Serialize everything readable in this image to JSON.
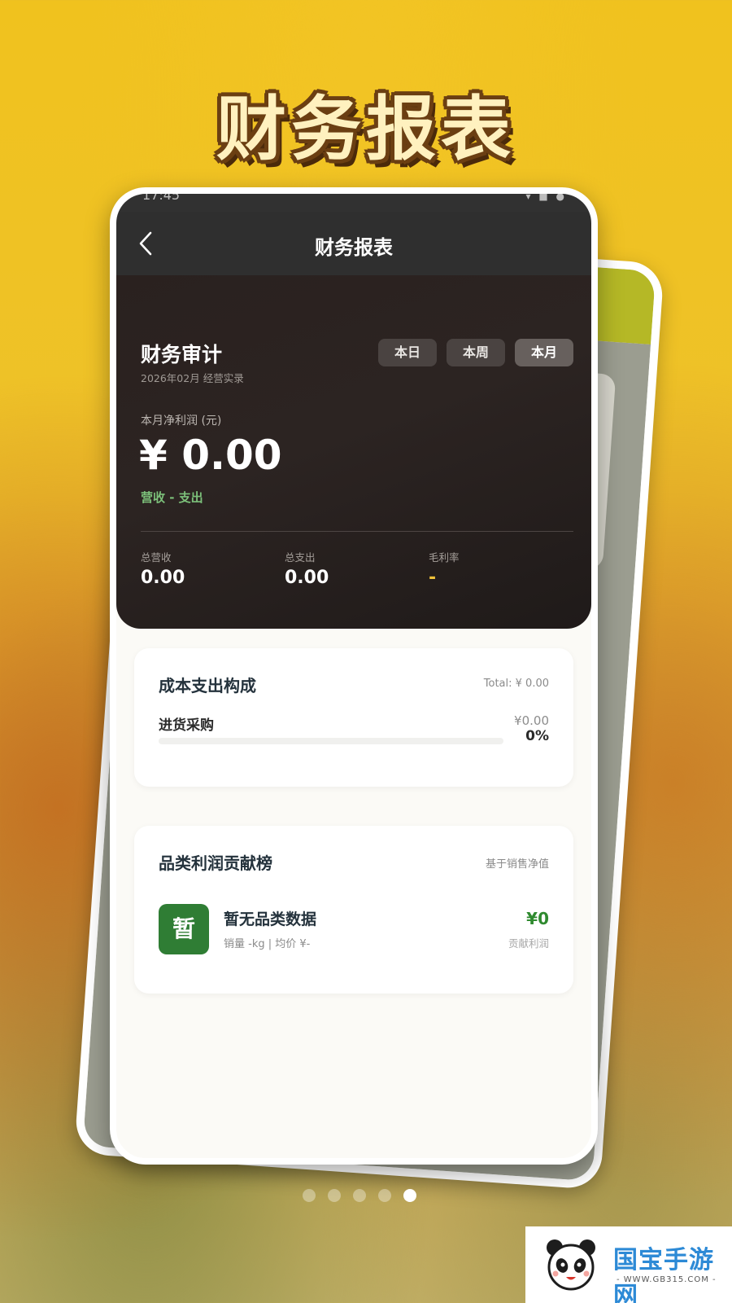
{
  "banner": {
    "title": "财务报表"
  },
  "status_bar": {
    "time": "17:45",
    "icons": "▾ ■ ●"
  },
  "navbar": {
    "title": "财务报表"
  },
  "audit": {
    "title": "财务审计",
    "subtitle": "2026年02月 经营实录",
    "periods": [
      "本日",
      "本周",
      "本月"
    ],
    "active_period": "本月",
    "net_profit_label": "本月净利润 (元)",
    "net_profit_value": "¥ 0.00",
    "formula": "营收 - 支出",
    "stats": [
      {
        "label": "总营收",
        "value": "0.00"
      },
      {
        "label": "总支出",
        "value": "0.00"
      },
      {
        "label": "毛利率",
        "value": "-"
      }
    ]
  },
  "cost_card": {
    "title": "成本支出构成",
    "total": "Total: ¥ 0.00",
    "items": [
      {
        "label": "进货采购",
        "amount": "¥0.00",
        "percent": "0%",
        "fill": 0
      }
    ]
  },
  "category_card": {
    "title": "品类利润贡献榜",
    "meta": "基于销售净值",
    "items": [
      {
        "icon_char": "暂",
        "name": "暂无品类数据",
        "desc": "销量 -kg | 均价 ¥-",
        "profit": "¥0",
        "profit_label": "贡献利润"
      }
    ]
  },
  "pager": {
    "count": 5,
    "active_index": 4
  },
  "watermark": {
    "logo_text": "国宝手游网",
    "url": "- WWW.GB315.COM -"
  },
  "colors": {
    "accent_green": "#2f8a2f",
    "gold": "#f0c23a",
    "hero_bg": "#2a211f",
    "nav_bg": "#2f2f2f"
  }
}
